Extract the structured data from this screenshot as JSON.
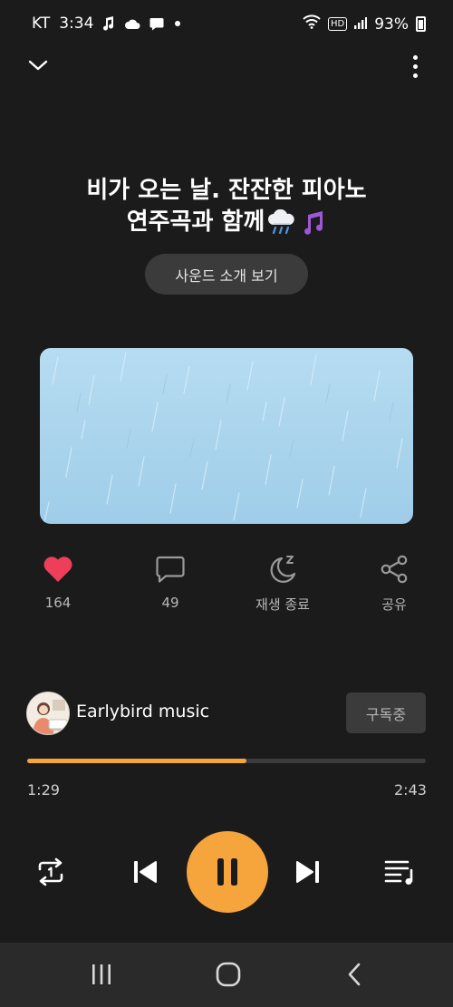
{
  "status_bar": {
    "carrier": "KT",
    "time": "3:34",
    "battery": "93%",
    "network_badge": "HD",
    "icons": [
      "music-note-icon",
      "cloud-icon",
      "chat-bubble-icon",
      "dot-icon",
      "wifi-icon",
      "signal-icon",
      "battery-icon"
    ]
  },
  "nav": {
    "collapse_icon": "chevron-down-icon",
    "more_icon": "more-vertical-icon"
  },
  "track": {
    "title_line1": "비가 오는 날. 잔잔한 피아노",
    "title_line2": "연주곡과 함께",
    "title_emojis": [
      "rain-cloud-emoji",
      "music-notes-emoji"
    ],
    "sound_intro_label": "사운드 소개 보기"
  },
  "actions": {
    "like_count": "164",
    "comment_count": "49",
    "sleep_label": "재생 종료",
    "share_label": "공유"
  },
  "channel": {
    "name": "Earlybird music",
    "subscribe_label": "구독중"
  },
  "playback": {
    "current_time": "1:29",
    "total_time": "2:43",
    "progress_fraction": 0.55,
    "is_playing": true
  },
  "colors": {
    "accent": "#f6a43c",
    "like": "#ee3e5a",
    "background": "#1c1b1c",
    "image_sky": "#a9d4ec"
  }
}
